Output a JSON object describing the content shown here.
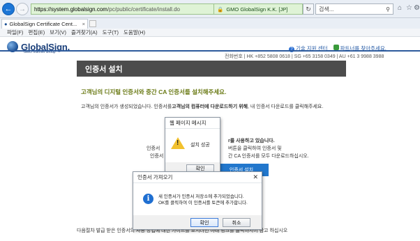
{
  "browser": {
    "url_domain": "https://system.globalsign.com",
    "url_path": "/pc/public/certificate/install.do",
    "cert_label": "GMO GlobalSign K.K. [JP]",
    "search_placeholder": "검색...",
    "tab_title": "GlobalSign Certificate Cent...",
    "menu": [
      "파일(F)",
      "편집(E)",
      "보기(V)",
      "즐겨찾기(A)",
      "도구(T)",
      "도움말(H)"
    ]
  },
  "page": {
    "logo_text": "GlobalSign.",
    "logo_sub": "GMO Internet Group",
    "link_support": "기술 지원 센터",
    "link_partner": "파트너를 찾아주세요.",
    "phone": "전화번호 | HK +852 5808 0618 | SG +65 3158 0349 | AU +61 3 9988 3988",
    "title": "인증서 설치",
    "headline": "고객님의 디지털 인증서와 중간 CA 인증서를 설치해주세요.",
    "body_pre": "고객님의 인증서가 생성되었습니다. 인증서를",
    "body_bold": "고객님의 컴퓨터에 다운로드하기 위해",
    "body_post": ", 내 인증서 다운로드를 클릭해주세요.",
    "partial1": "r를 사용하고 있습니다.",
    "partial2": "버튼을 클릭하여 인증서 및",
    "partial4": "인증서",
    "partial3": "인증서",
    "partial3b": "간 CA 인증서를 모두 다운로드하십시오.",
    "install_button": "인증서 설치",
    "bottom_text": "다음절차 발급 받은 인증서의 사용 방법에 대한 가이드를 보시려면 아래 링크를 클릭하시어 참고 하십시오"
  },
  "dialog_webpage": {
    "title": "웹 페이지 메시지",
    "message": "설치 성공",
    "ok": "확인"
  },
  "dialog_cert": {
    "title": "인증서 가져오기",
    "line1": "새 인증서가 인증서 저장소에 추가되었습니다.",
    "line2": "OK를 클릭하여 이 인증서를 토큰에 추가합니다.",
    "ok": "확인",
    "cancel": "취소"
  }
}
